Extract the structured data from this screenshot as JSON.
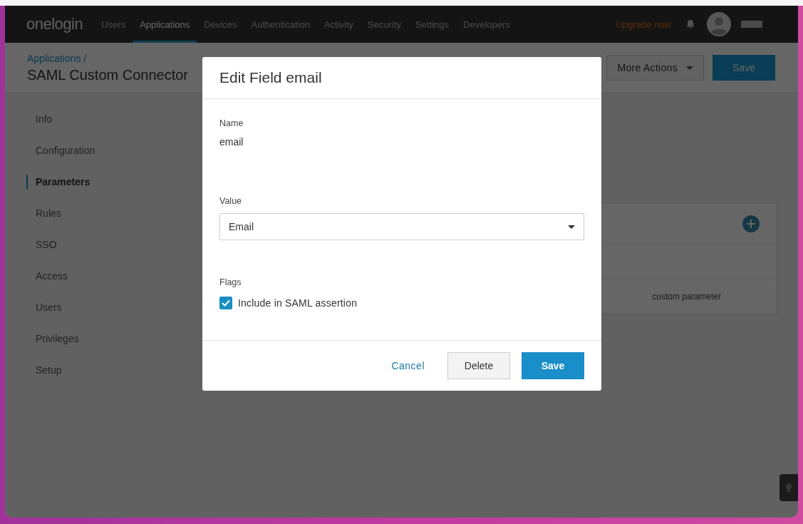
{
  "nav": {
    "logo": "onelogin",
    "items": [
      {
        "label": "Users",
        "selected": false
      },
      {
        "label": "Applications",
        "selected": true
      },
      {
        "label": "Devices",
        "selected": false
      },
      {
        "label": "Authentication",
        "selected": false
      },
      {
        "label": "Activity",
        "selected": false
      },
      {
        "label": "Security",
        "selected": false
      },
      {
        "label": "Settings",
        "selected": false
      },
      {
        "label": "Developers",
        "selected": false
      }
    ],
    "upgrade": "Upgrade now"
  },
  "header": {
    "breadcrumb": "Applications /",
    "title": "SAML Custom Connector",
    "more_actions": "More Actions",
    "save": "Save"
  },
  "sidebar": {
    "items": [
      {
        "label": "Info",
        "selected": false
      },
      {
        "label": "Configuration",
        "selected": false
      },
      {
        "label": "Parameters",
        "selected": true
      },
      {
        "label": "Rules",
        "selected": false
      },
      {
        "label": "SSO",
        "selected": false
      },
      {
        "label": "Access",
        "selected": false
      },
      {
        "label": "Users",
        "selected": false
      },
      {
        "label": "Privileges",
        "selected": false
      },
      {
        "label": "Setup",
        "selected": false
      }
    ]
  },
  "table": {
    "rows": [
      {
        "column_2": "custom parameter"
      }
    ]
  },
  "dialog": {
    "title": "Edit Field email",
    "name_label": "Name",
    "name_value": "email",
    "value_label": "Value",
    "value": "Email",
    "flags_label": "Flags",
    "flags": [
      {
        "label": "Include in SAML assertion",
        "checked": true
      }
    ],
    "cancel": "Cancel",
    "delete": "Delete",
    "save": "Save"
  }
}
